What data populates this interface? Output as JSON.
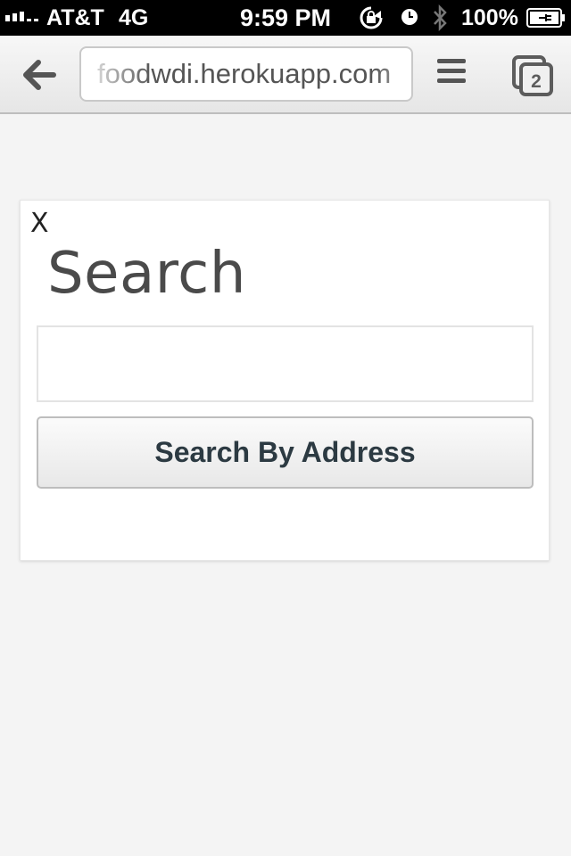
{
  "status_bar": {
    "carrier": "AT&T",
    "network": "4G",
    "time": "9:59 PM",
    "battery_percent": "100%",
    "icons": [
      "signal-icon",
      "rotation-lock-icon",
      "alarm-icon",
      "bluetooth-icon",
      "battery-charging-icon"
    ]
  },
  "browser": {
    "url": "foodwdi.herokuapp.com",
    "tab_count": "2",
    "icons": [
      "back-arrow-icon",
      "menu-icon",
      "tabs-icon"
    ]
  },
  "modal": {
    "close_label": "X",
    "title": "Search",
    "input_value": "",
    "input_placeholder": "",
    "button_label": "Search By Address"
  }
}
